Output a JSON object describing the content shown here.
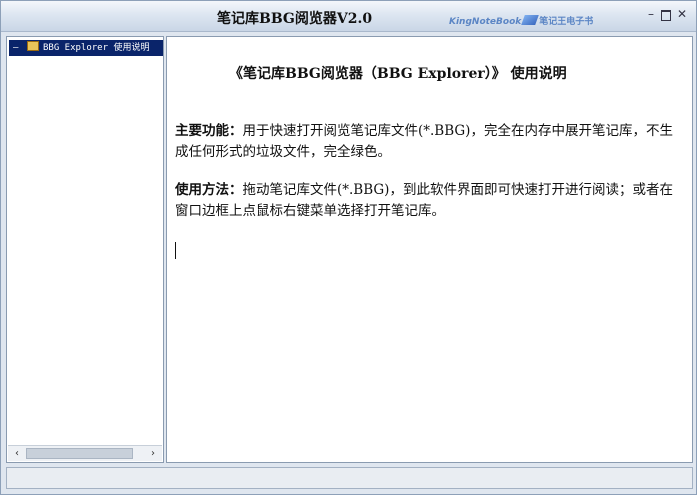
{
  "window": {
    "title": "笔记库BBG阅览器V2.0",
    "brand_en": "KingNoteBook",
    "brand_cn": "笔记王电子书",
    "minimize_glyph": "–",
    "close_glyph": "✕"
  },
  "tree": {
    "items": [
      {
        "label": "BBG Explorer 使用说明",
        "icon": "book-icon"
      }
    ],
    "scroll_left": "‹",
    "scroll_right": "›"
  },
  "document": {
    "title": "《笔记库BBG阅览器（BBG Explorer）》 使用说明",
    "features_label": "主要功能：",
    "features_text": "用于快速打开阅览笔记库文件(*.BBG)，完全在内存中展开笔记库，不生成任何形式的垃圾文件，完全绿色。",
    "usage_label": "使用方法：",
    "usage_text": "拖动笔记库文件(*.BBG)，到此软件界面即可快速打开进行阅读；或者在窗口边框上点鼠标右键菜单选择打开笔记库。"
  },
  "status": {
    "text": ""
  }
}
